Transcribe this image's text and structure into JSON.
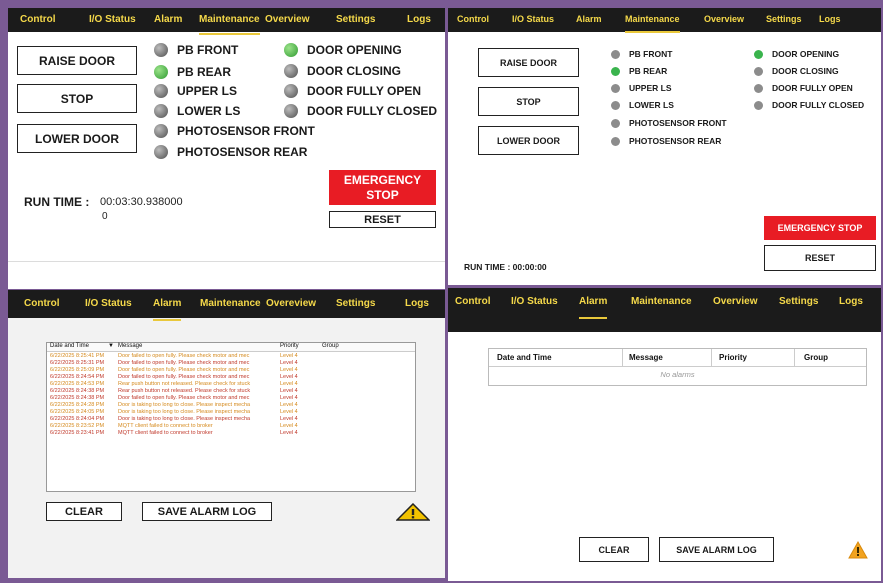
{
  "nav": [
    "Control",
    "I/O Status",
    "Alarm",
    "Maintenance",
    "Overeview",
    "Settings",
    "Logs"
  ],
  "nav_alt": [
    "Control",
    "I/O Status",
    "Alarm",
    "Maintenance",
    "Overview",
    "Settings",
    "Logs"
  ],
  "buttons": {
    "raise": "RAISE DOOR",
    "stop": "STOP",
    "lower": "LOWER DOOR",
    "emergency_top": "EMERGENCY STOP",
    "emergency": "EMERGENCY STOP",
    "reset": "RESET",
    "clear": "CLEAR",
    "save": "SAVE ALARM LOG"
  },
  "inputs": {
    "pb_front": "PB FRONT",
    "pb_rear": "PB REAR",
    "upper_ls": "UPPER LS",
    "lower_ls": "LOWER LS",
    "photo_front": "PHOTOSENSOR FRONT",
    "photo_rear": "PHOTOSENSOR REAR"
  },
  "outputs": {
    "opening": "DOOR OPENING",
    "closing": "DOOR CLOSING",
    "fully_open": "DOOR FULLY OPEN",
    "fully_closed": "DOOR FULLY CLOSED"
  },
  "active": {
    "pb_rear": true,
    "opening": true
  },
  "runtime": {
    "label": "RUN TIME :",
    "value_1": "00:03:30.938000",
    "value_1b": "0",
    "label_2": "RUN TIME : 00:00:00"
  },
  "alarm_table": {
    "headers": [
      "Date and Time",
      "Message",
      "Priority",
      "Group"
    ],
    "rows": [
      {
        "time": "6/22/2025 8:25:41 PM",
        "msg": "Door failed to open fully. Please check motor and mec",
        "pri": "Level 4",
        "color": "#d58a1e"
      },
      {
        "time": "6/22/2025 8:25:31 PM",
        "msg": "Door failed to open fully. Please check motor and mec",
        "pri": "Level 4",
        "color": "#c0392b"
      },
      {
        "time": "6/22/2025 8:25:09 PM",
        "msg": "Door failed to open fully. Please check motor and mec",
        "pri": "Level 4",
        "color": "#d58a1e"
      },
      {
        "time": "6/22/2025 8:24:54 PM",
        "msg": "Door failed to open fully. Please check motor and mec",
        "pri": "Level 4",
        "color": "#c0392b"
      },
      {
        "time": "6/22/2025 8:24:53 PM",
        "msg": "Rear push button not released. Please check for stuck",
        "pri": "Level 4",
        "color": "#d58a1e"
      },
      {
        "time": "6/22/2025 8:24:38 PM",
        "msg": "Rear push button not released. Please check for stuck",
        "pri": "Level 4",
        "color": "#c0392b"
      },
      {
        "time": "6/22/2025 8:24:38 PM",
        "msg": "Door failed to open fully. Please check motor and mec",
        "pri": "Level 4",
        "color": "#c0392b"
      },
      {
        "time": "6/22/2025 8:24:28 PM",
        "msg": "Door is taking too long to close. Please inspect mecha",
        "pri": "Level 4",
        "color": "#d58a1e"
      },
      {
        "time": "6/22/2025 8:24:05 PM",
        "msg": "Door is taking too long to close. Please inspect mecha",
        "pri": "Level 4",
        "color": "#d58a1e"
      },
      {
        "time": "6/22/2025 8:24:04 PM",
        "msg": "Door is taking too long to close. Please inspect mecha",
        "pri": "Level 4",
        "color": "#c0392b"
      },
      {
        "time": "6/22/2025 8:23:52 PM",
        "msg": "MQTT client failed to connect to broker",
        "pri": "Level 4",
        "color": "#d58a1e"
      },
      {
        "time": "6/22/2025 8:23:41 PM",
        "msg": "MQTT client failed to connect to broker",
        "pri": "Level 4",
        "color": "#c0392b"
      }
    ]
  },
  "empty_table": {
    "headers": [
      "Date and Time",
      "Message",
      "Priority",
      "Group"
    ],
    "empty_text": "No alarms"
  },
  "colors": {
    "nav_bg": "#1b1b1b",
    "nav_text": "#f5d94a",
    "active_green": "#39b54a",
    "emergency_red": "#e81c24",
    "warning_yellow": "#f2c200"
  }
}
